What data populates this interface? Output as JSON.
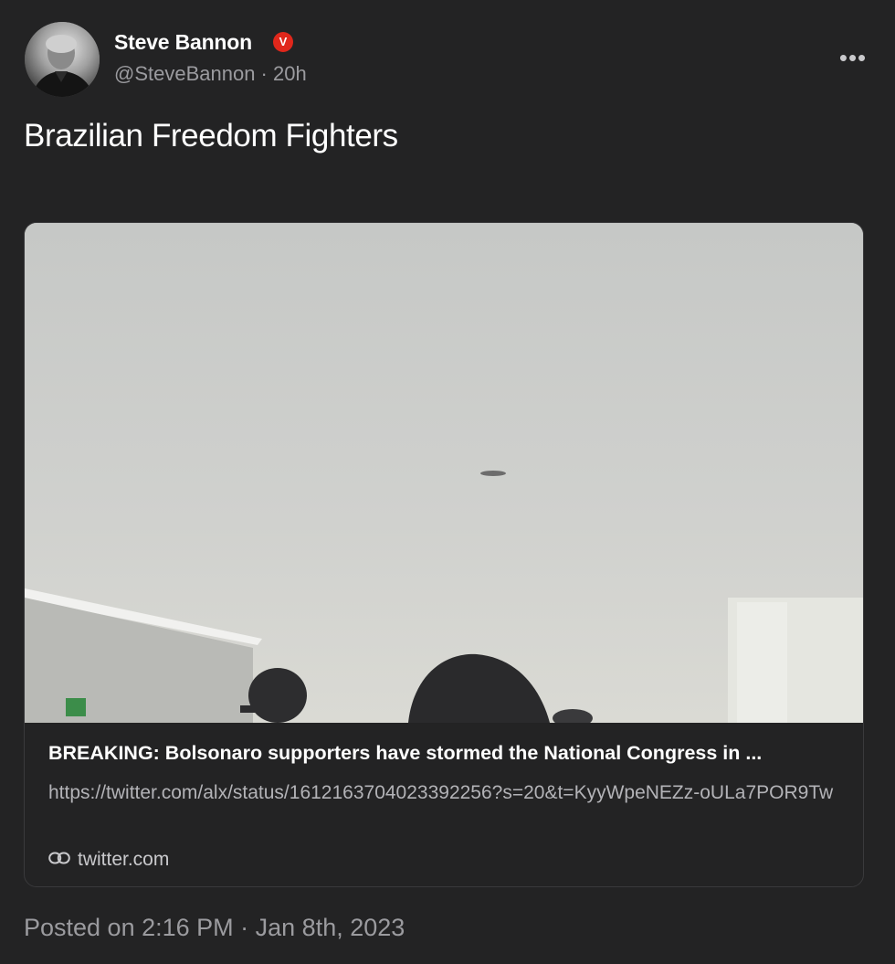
{
  "post": {
    "author": {
      "name": "Steve Bannon",
      "verified_badge": "V",
      "handle_line": "@SteveBannon · 20h"
    },
    "more_icon": "more-horizontal-icon",
    "text": "Brazilian Freedom Fighters",
    "link_card": {
      "title": "BREAKING: Bolsonaro supporters have stormed the National Congress in ...",
      "url": "https://twitter.com/alx/status/1612163704023392256?s=20&t=KyyWpeNEZz-oULa7POR9Tw",
      "domain": "twitter.com",
      "domain_icon": "link-icon"
    },
    "posted_on": "Posted on 2:16 PM · Jan 8th, 2023"
  },
  "colors": {
    "background": "#232324",
    "verified": "#e0271b",
    "muted_text": "#9b9b9f",
    "card_border": "#3a3a3c"
  }
}
